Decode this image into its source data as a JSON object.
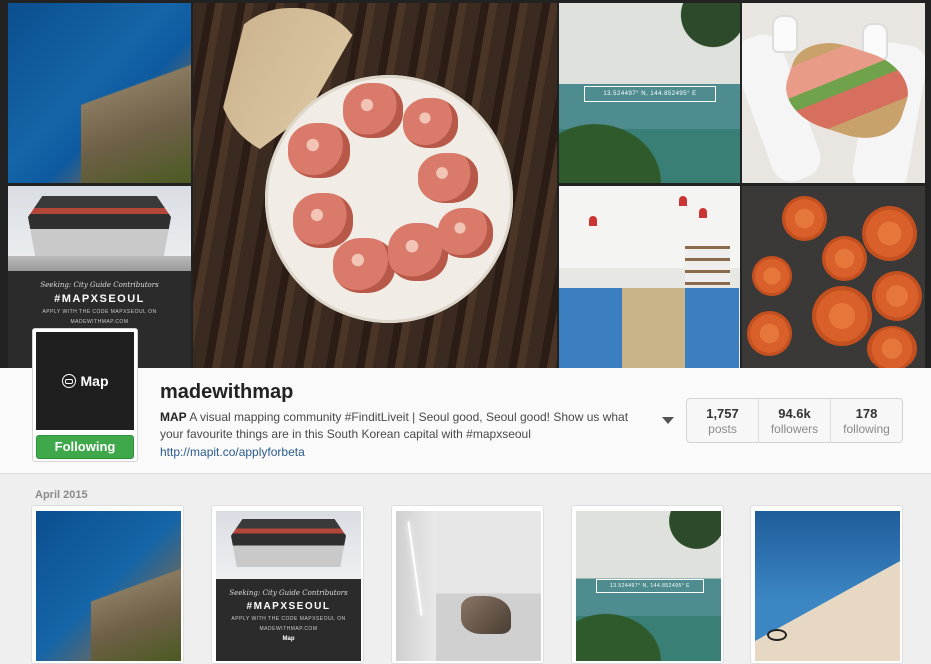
{
  "header_tiles": {
    "palace_subtitle": "Seeking: City Guide Contributors",
    "palace_tag": "#MAPXSEOUL",
    "palace_small1": "APPLY WITH THE CODE MAPXSEOUL ON",
    "palace_small2": "MADEWITHMAP.COM",
    "coordinates": "13.524497° N, 144.852495° E"
  },
  "profile": {
    "avatar_label": "Map",
    "follow_button": "Following",
    "username": "madewithmap",
    "bio_name": "MAP",
    "bio_text": " A visual mapping community #FinditLiveit | Seoul good, Seoul good! Show us what your favourite things are in this South Korean capital with #mapxseoul",
    "link": "http://mapit.co/applyforbeta"
  },
  "stats": [
    {
      "num": "1,757",
      "label": "posts"
    },
    {
      "num": "94.6k",
      "label": "followers"
    },
    {
      "num": "178",
      "label": "following"
    }
  ],
  "feed": {
    "month": "April 2015",
    "palace_subtitle": "Seeking: City Guide Contributors",
    "palace_tag": "#MAPXSEOUL",
    "palace_small1": "APPLY WITH THE CODE MAPXSEOUL ON",
    "palace_small2": "MADEWITHMAP.COM",
    "palace_brand": "Map",
    "coordinates": "13.524497° N, 144.852495° E"
  }
}
